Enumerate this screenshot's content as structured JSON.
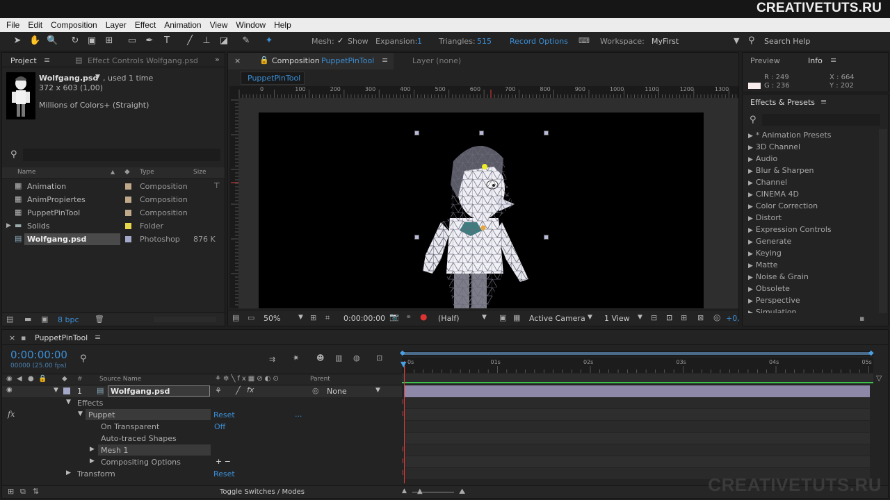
{
  "watermark": "CREATIVETUTS.RU",
  "menu": [
    "File",
    "Edit",
    "Composition",
    "Layer",
    "Effect",
    "Animation",
    "View",
    "Window",
    "Help"
  ],
  "toolbar": {
    "mesh_label": "Mesh:",
    "show_label": "Show",
    "expansion_label": "Expansion:",
    "expansion_value": "1",
    "triangles_label": "Triangles:",
    "triangles_value": "515",
    "record_options": "Record Options",
    "workspace_label": "Workspace:",
    "workspace_value": "MyFirst",
    "search_help": "Search Help"
  },
  "project": {
    "tab_project": "Project",
    "tab_effect_controls": "Effect Controls Wolfgang.psd",
    "item_name": "Wolfgang.psd",
    "item_used": ", used 1 time",
    "item_dims": "372 x 603 (1,00)",
    "item_colors": "Millions of Colors+ (Straight)",
    "col_name": "Name",
    "col_type": "Type",
    "col_size": "Size",
    "bpc": "8 bpc",
    "items": [
      {
        "name": "Animation",
        "type": "Composition",
        "size": "",
        "color": "#c0a98a"
      },
      {
        "name": "AnimPropiertes",
        "type": "Composition",
        "size": "",
        "color": "#c0a98a"
      },
      {
        "name": "PuppetPinTool",
        "type": "Composition",
        "size": "",
        "color": "#c0a98a"
      },
      {
        "name": "Solids",
        "type": "Folder",
        "size": "",
        "color": "#e6d84a"
      },
      {
        "name": "Wolfgang.psd",
        "type": "Photoshop",
        "size": "876 K",
        "color": "#a4a8c8"
      }
    ]
  },
  "comp": {
    "tab_prefix": "Composition",
    "tab_name": "PuppetPinTool",
    "tab_layer": "Layer (none)",
    "subtab": "PuppetPinTool",
    "ruler_labels": [
      "0",
      "100",
      "200",
      "300",
      "400",
      "500",
      "600",
      "700",
      "800",
      "900",
      "1000",
      "1100",
      "1200",
      "1300"
    ],
    "zoom": "50%",
    "timecode": "0:00:00:00",
    "resolution": "(Half)",
    "camera": "Active Camera",
    "views": "1 View",
    "offset": "+0,"
  },
  "info": {
    "tab_preview": "Preview",
    "tab_info": "Info",
    "r": "R : 249",
    "g": "G : 236",
    "x": "X : 664",
    "y": "Y : 202"
  },
  "effects_presets": {
    "title": "Effects & Presets",
    "items": [
      "* Animation Presets",
      "3D Channel",
      "Audio",
      "Blur & Sharpen",
      "Channel",
      "CINEMA 4D",
      "Color Correction",
      "Distort",
      "Expression Controls",
      "Generate",
      "Keying",
      "Matte",
      "Noise & Grain",
      "Obsolete",
      "Perspective",
      "Simulation"
    ]
  },
  "timeline": {
    "tab": "PuppetPinTool",
    "timecode": "0:00:00:00",
    "frames": "00000 (25.00 fps)",
    "col_source": "Source Name",
    "col_parent": "Parent",
    "layer_num": "1",
    "layer_name": "Wolfgang.psd",
    "parent_value": "None",
    "effects": "Effects",
    "puppet": "Puppet",
    "reset": "Reset",
    "on_transparent": "On Transparent",
    "off": "Off",
    "auto_traced": "Auto-traced Shapes",
    "mesh": "Mesh 1",
    "compositing": "Compositing Options",
    "transform": "Transform",
    "ellipsis": "...",
    "plusminus": "+ −",
    "fx": "fx",
    "toggle": "Toggle Switches / Modes",
    "time_labels": [
      "0s",
      "01s",
      "02s",
      "03s",
      "04s",
      "05s"
    ]
  }
}
